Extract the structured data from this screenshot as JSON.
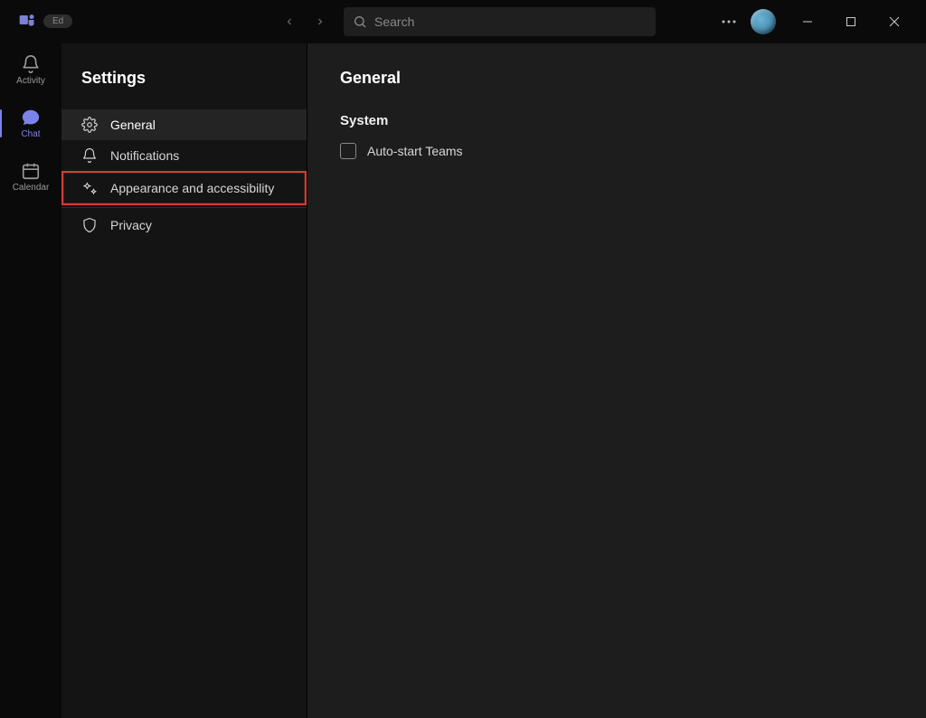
{
  "titlebar": {
    "org_label": "Ed",
    "search_placeholder": "Search"
  },
  "rail": {
    "items": [
      {
        "label": "Activity"
      },
      {
        "label": "Chat"
      },
      {
        "label": "Calendar"
      }
    ]
  },
  "settings": {
    "title": "Settings",
    "nav": [
      {
        "label": "General"
      },
      {
        "label": "Notifications"
      },
      {
        "label": "Appearance and accessibility"
      },
      {
        "label": "Privacy"
      }
    ],
    "selected_index": 0,
    "highlighted_index": 2
  },
  "content": {
    "heading": "General",
    "section": "System",
    "options": [
      {
        "label": "Auto-start Teams",
        "checked": false
      }
    ]
  }
}
